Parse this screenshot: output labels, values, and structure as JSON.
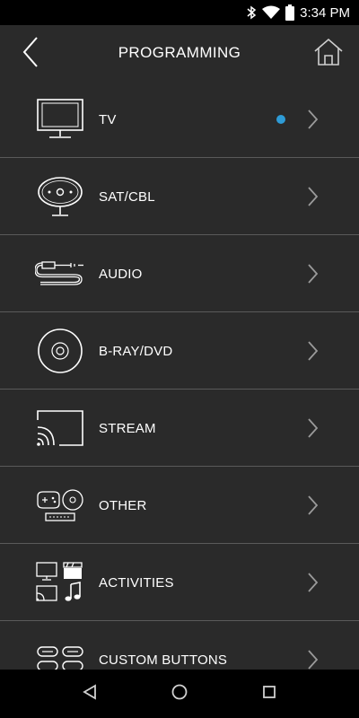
{
  "status_bar": {
    "time": "3:34 PM",
    "icons": [
      "bluetooth-icon",
      "wifi-icon",
      "battery-icon"
    ]
  },
  "header": {
    "title": "PROGRAMMING",
    "back_icon": "chevron-left-icon",
    "home_icon": "home-icon"
  },
  "list": {
    "items": [
      {
        "label": "TV",
        "icon": "tv-icon",
        "has_indicator": true
      },
      {
        "label": "SAT/CBL",
        "icon": "satellite-dish-icon",
        "has_indicator": false
      },
      {
        "label": "AUDIO",
        "icon": "audio-cable-icon",
        "has_indicator": false
      },
      {
        "label": "B-RAY/DVD",
        "icon": "disc-icon",
        "has_indicator": false
      },
      {
        "label": "STREAM",
        "icon": "cast-icon",
        "has_indicator": false
      },
      {
        "label": "OTHER",
        "icon": "gamepad-disc-icon",
        "has_indicator": false
      },
      {
        "label": "ACTIVITIES",
        "icon": "activities-icon",
        "has_indicator": false
      },
      {
        "label": "CUSTOM BUTTONS",
        "icon": "custom-buttons-icon",
        "has_indicator": false
      }
    ]
  },
  "colors": {
    "background": "#2a2a2a",
    "bars": "#000000",
    "indicator": "#2e9bd6",
    "divider": "#5a5a5a",
    "text": "#ffffff"
  },
  "nav_bar": {
    "icons": [
      "back-triangle-icon",
      "home-circle-icon",
      "recents-square-icon"
    ]
  }
}
